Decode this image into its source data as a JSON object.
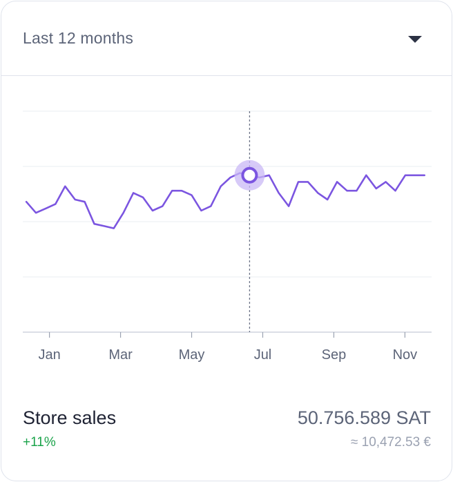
{
  "period_select": {
    "label": "Last 12 months",
    "icon": "caret-down-icon"
  },
  "summary": {
    "title": "Store sales",
    "change": "+11%",
    "value": "50.756.589 SAT",
    "converted": "≈ 10,472.53 €"
  },
  "colors": {
    "line": "#7b55e0",
    "marker_halo": "#c9b8f5",
    "grid": "#e9ecf2",
    "change_positive": "#1aa34a"
  },
  "chart_data": {
    "type": "line",
    "title": "",
    "xlabel": "",
    "ylabel": "",
    "x_ticks": [
      "Jan",
      "Mar",
      "May",
      "Jul",
      "Sep",
      "Nov"
    ],
    "x_range": [
      -0.75,
      10.75
    ],
    "ylim": [
      0,
      100
    ],
    "grid": true,
    "y_gridlines": [
      0,
      25,
      50,
      75,
      100
    ],
    "highlighted_index": 23,
    "series": [
      {
        "x": [
          -0.65,
          -0.38,
          -0.1,
          0.17,
          0.44,
          0.72,
          0.99,
          1.26,
          1.54,
          1.81,
          2.08,
          2.36,
          2.63,
          2.9,
          3.18,
          3.45,
          3.72,
          4.0,
          4.27,
          4.54,
          4.82,
          5.09,
          5.36,
          5.63,
          5.91,
          6.18,
          6.45,
          6.73,
          7.0,
          7.27,
          7.55,
          7.82,
          8.09,
          8.37,
          8.64,
          8.91,
          9.19,
          9.46,
          9.73,
          10.01,
          10.28,
          10.55
        ],
        "values": [
          59,
          54,
          56,
          58,
          66,
          60,
          59,
          49,
          48,
          47,
          54,
          63,
          61,
          55,
          57,
          64,
          64,
          62,
          55,
          57,
          66,
          70,
          72,
          71,
          70,
          71,
          63,
          57,
          68,
          68,
          63,
          60,
          68,
          64,
          64,
          71,
          65,
          68,
          64,
          71,
          71,
          71
        ]
      }
    ]
  }
}
